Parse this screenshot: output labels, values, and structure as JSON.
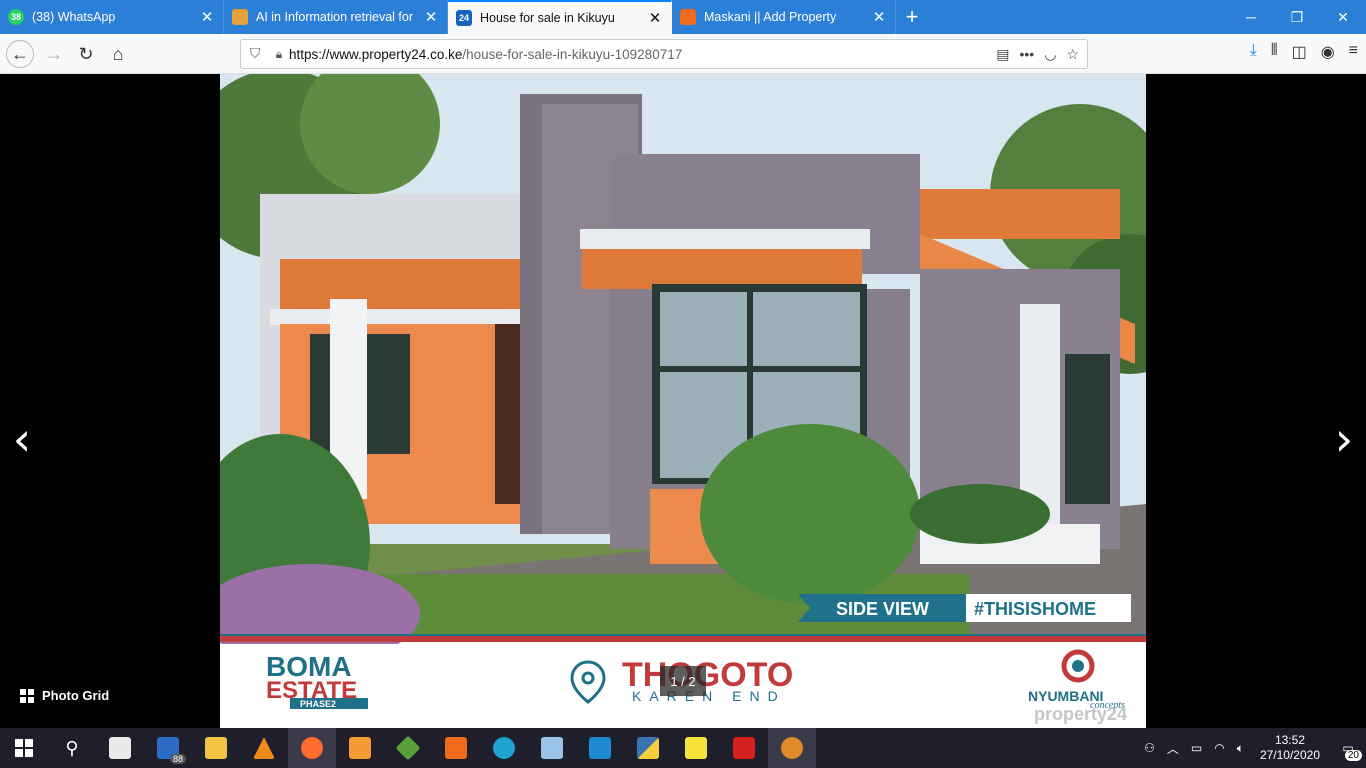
{
  "browser": {
    "tabs": [
      {
        "title": "(38) WhatsApp",
        "favicon_color": "#25d366",
        "favicon_text": "38"
      },
      {
        "title": "AI in Information retrieval for M",
        "favicon_color": "#e8a23a",
        "favicon_text": ""
      },
      {
        "title": "House for sale in Kikuyu",
        "favicon_color": "#1565c0",
        "favicon_text": "24"
      },
      {
        "title": "Maskani || Add Property",
        "favicon_color": "#f26b1d",
        "favicon_text": ""
      }
    ],
    "url_host": "https://www.property24.co.ke",
    "url_path": "/house-for-sale-in-kikuyu-109280717"
  },
  "gallery": {
    "counter": "1 / 2",
    "photo_grid_label": "Photo Grid"
  },
  "photo_text": {
    "side_view": "SIDE VIEW",
    "hashtag": "#THISISHOME",
    "boma": "BOMA",
    "estate": "ESTATE",
    "phase": "PHASE2",
    "thogoto": "THOGOTO",
    "karen_end": "KAREN END",
    "nyumbani": "NYUMBANI",
    "concepts": "concepts",
    "watermark": "property24"
  },
  "taskbar": {
    "mail_badge": "88",
    "time": "13:52",
    "date": "27/10/2020",
    "notif_count": "20"
  }
}
